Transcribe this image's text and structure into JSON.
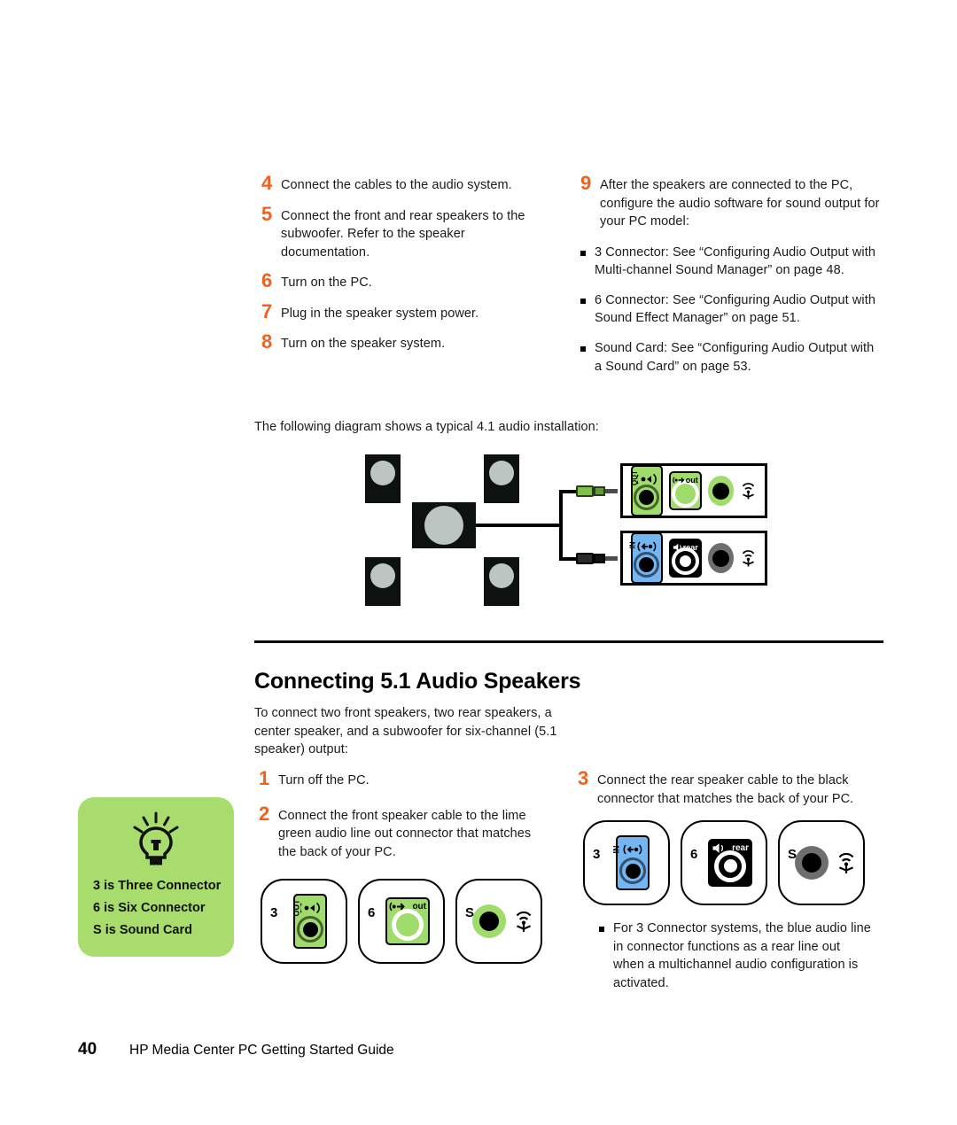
{
  "doc": {
    "footer_page": "40",
    "footer_title": "HP Media Center PC Getting Started Guide"
  },
  "colors": {
    "step_number_orange": "#F2611B",
    "lime_green": "#9FDC6B",
    "callout_green": "#A8DC6C",
    "line_in_blue": "#74B6F2",
    "black": "#000000",
    "speaker_body": "#0d1211",
    "speaker_cone": "#bdc5c2",
    "sound_card_gray": "#6e6e6e"
  },
  "section_41": {
    "steps_left": [
      {
        "num": "4",
        "text": "Connect the cables to the audio system."
      },
      {
        "num": "5",
        "text": "Connect the front and rear speakers to the subwoofer. Refer to the speaker documentation."
      },
      {
        "num": "6",
        "text": "Turn on the PC."
      },
      {
        "num": "7",
        "text": "Plug in the speaker system power."
      },
      {
        "num": "8",
        "text": "Turn on the speaker system."
      }
    ],
    "step_9": {
      "num": "9",
      "text": "After the speakers are connected to the PC, configure the audio software for sound output for your PC model:",
      "bullets": [
        "3 Connector: See “Configuring Audio Output with Multi-channel Sound Manager” on page 48.",
        "6 Connector: See “Configuring Audio Output with Sound Effect Manager” on page 51.",
        "Sound Card: See “Configuring Audio Output with a Sound Card” on page 53."
      ]
    },
    "intro": "The following diagram shows a typical 4.1 audio installation:",
    "diagram": {
      "speakers": [
        {
          "name": "front-left-speaker",
          "type": "small"
        },
        {
          "name": "front-right-speaker",
          "type": "small"
        },
        {
          "name": "subwoofer",
          "type": "large"
        },
        {
          "name": "rear-left-speaker",
          "type": "small"
        },
        {
          "name": "rear-right-speaker",
          "type": "small"
        }
      ],
      "cables": [
        {
          "name": "lime-green-cable",
          "color": "#9FDC6B",
          "connects_to": "line-out"
        },
        {
          "name": "black-cable",
          "color": "#1a1a1a",
          "connects_to": "rear-out"
        }
      ],
      "panel_top": {
        "name": "lime-line-out-panel",
        "ports": [
          {
            "label": "OUT",
            "style": "lime",
            "icon": "speaker-out-icon"
          },
          {
            "label": "out",
            "style": "lime",
            "icon": "line-out-icon"
          },
          {
            "label": "",
            "style": "lime-plain",
            "icon": "sound-card-icon"
          }
        ]
      },
      "panel_bottom": {
        "name": "rear-out-panel",
        "ports": [
          {
            "label": "IN",
            "style": "blue",
            "icon": "line-in-icon"
          },
          {
            "label": "rear",
            "style": "black",
            "icon": "rear-speaker-icon"
          },
          {
            "label": "",
            "style": "gray-plain",
            "icon": "sound-card-icon"
          }
        ]
      }
    }
  },
  "section_51": {
    "heading": "Connecting 5.1 Audio Speakers",
    "intro": "To connect two front speakers, two rear speakers, a center speaker, and a subwoofer for six-channel (5.1 speaker) output:",
    "steps_left": [
      {
        "num": "1",
        "text": "Turn off the PC."
      },
      {
        "num": "2",
        "text": "Connect the front speaker cable to the lime green audio line out connector that matches the back of your PC."
      }
    ],
    "step_3": {
      "num": "3",
      "text": "Connect the rear speaker cable to the black connector that matches the back of your PC."
    },
    "bullet_note": "For 3 Connector systems, the blue audio line in connector functions as a rear line out when a multichannel audio configuration is activated.",
    "chips_left": [
      {
        "label": "3",
        "variant": "lime-tall",
        "icon": "speaker-out-icon",
        "caption": "OUT"
      },
      {
        "label": "6",
        "variant": "lime-square",
        "icon": "line-out-icon",
        "caption": "out"
      },
      {
        "label": "S",
        "variant": "lime-plain",
        "icon": "sound-card-icon",
        "caption": ""
      }
    ],
    "chips_right": [
      {
        "label": "3",
        "variant": "blue-tall",
        "icon": "line-in-icon",
        "caption": "IN"
      },
      {
        "label": "6",
        "variant": "black-square",
        "icon": "rear-speaker-icon",
        "caption": "rear"
      },
      {
        "label": "S",
        "variant": "gray-plain",
        "icon": "sound-card-icon",
        "caption": ""
      }
    ]
  },
  "callout": {
    "icon": "lightbulb-icon",
    "lines": [
      "3 is Three Connector",
      "6 is Six Connector",
      "S is Sound Card"
    ]
  }
}
